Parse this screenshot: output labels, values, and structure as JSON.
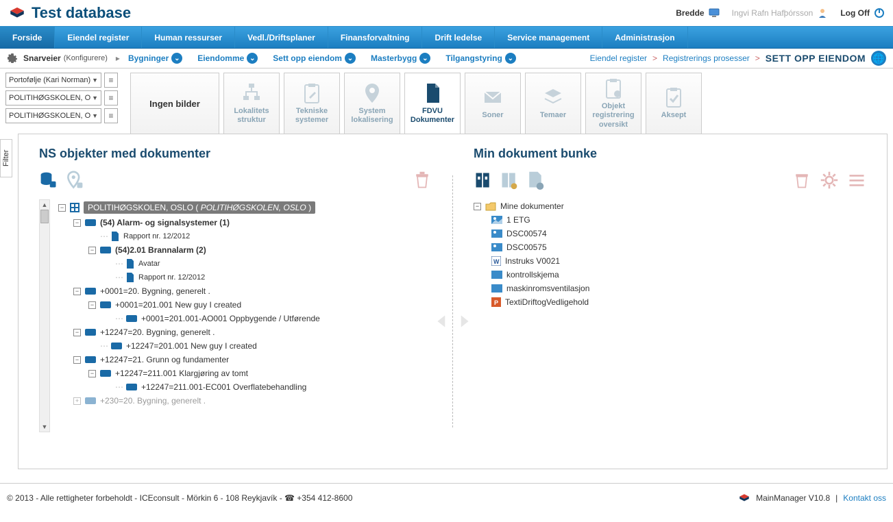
{
  "header": {
    "title": "Test database",
    "bredde": "Bredde",
    "user": "Ingvi Rafn Hafþórsson",
    "logoff": "Log Off"
  },
  "nav": [
    "Forside",
    "Eiendel register",
    "Human ressurser",
    "Vedl./Driftsplaner",
    "Finansforvaltning",
    "Drift ledelse",
    "Service management",
    "Administrasjon"
  ],
  "subbar": {
    "snarveier": "Snarveier",
    "konfig": "(Konfigurere)",
    "links": [
      "Bygninger",
      "Eiendomme",
      "Sett opp eiendom",
      "Masterbygg",
      "Tilgangstyring"
    ]
  },
  "breadcrumb": {
    "a": "Eiendel register",
    "b": "Registrerings prosesser",
    "final": "SETT OPP EIENDOM"
  },
  "selects": [
    "Portofølje (Kari Norman)",
    "POLITIHØGSKOLEN, O",
    "POLITIHØGSKOLEN, O"
  ],
  "cards": {
    "ingen": "Ingen bilder",
    "items": [
      {
        "l1": "Lokalitets",
        "l2": "struktur"
      },
      {
        "l1": "Tekniske",
        "l2": "systemer"
      },
      {
        "l1": "System",
        "l2": "lokalisering"
      },
      {
        "l1": "FDVU",
        "l2": "Dokumenter",
        "active": true
      },
      {
        "l1": "Soner",
        "l2": ""
      },
      {
        "l1": "Temaer",
        "l2": ""
      },
      {
        "l1": "Objekt",
        "l2": "registrering oversikt"
      },
      {
        "l1": "Aksept",
        "l2": ""
      }
    ]
  },
  "filter_tab": "Filter",
  "left_pane": {
    "title": "NS objekter med dokumenter",
    "root_a": "POLITIHØGSKOLEN, OSLO ( ",
    "root_b": "POLITIHØGSKOLEN, OSLO",
    "root_c": " )",
    "n54": "(54) Alarm- og signalsystemer (1)",
    "rapport": "Rapport nr. 12/2012",
    "n54_2": "(54)2.01 Brannalarm (2)",
    "avatar": "Avatar",
    "rapport2": "Rapport nr. 12/2012",
    "b1": "+0001=20. Bygning, generelt .",
    "b1a": "+0001=201.001 New guy I created",
    "b1b": "+0001=201.001-AO001 Oppbygende / Utførende",
    "b2": "+12247=20. Bygning, generelt .",
    "b2a": "+12247=201.001 New guy I created",
    "b3": "+12247=21. Grunn og fundamenter",
    "b3a": "+12247=211.001 Klargjøring av tomt",
    "b3b": "+12247=211.001-EC001 Overflatebehandling",
    "cut": "+230=20. Bygning, generelt ."
  },
  "right_pane": {
    "title": "Min dokument bunke",
    "root": "Mine dokumenter",
    "items": [
      "1 ETG",
      "DSC00574",
      "DSC00575",
      "Instruks V0021",
      "kontrollskjema",
      "maskinromsventilasjon",
      "TextiDriftogVedligehold"
    ]
  },
  "footer": {
    "left": "© 2013 - Alle rettigheter forbeholdt - ICEconsult - Mörkin 6 - 108 Reykjavík - ☎ +354 412-8600",
    "ver": "MainManager V10.8",
    "contact": "Kontakt oss"
  }
}
